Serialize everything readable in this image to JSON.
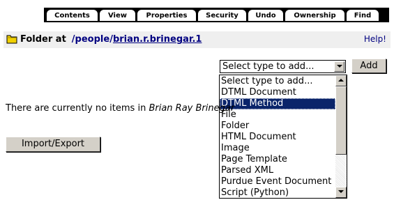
{
  "tabs": [
    {
      "label": "Contents",
      "active": true
    },
    {
      "label": "View"
    },
    {
      "label": "Properties"
    },
    {
      "label": "Security"
    },
    {
      "label": "Undo"
    },
    {
      "label": "Ownership"
    },
    {
      "label": "Find"
    }
  ],
  "header": {
    "prefix": "Folder at",
    "path_root": "/people",
    "path_sep": "/",
    "path_leaf": "brian.r.brinegar.1",
    "help": "Help!",
    "folder_icon": "folder-icon",
    "folder_icon_color": "#f0d000"
  },
  "add_form": {
    "selected_value": "Select type to add...",
    "add_label": "Add",
    "options": [
      "Select type to add...",
      "DTML Document",
      "DTML Method",
      "File",
      "Folder",
      "HTML Document",
      "Image",
      "Page Template",
      "Parsed XML",
      "Purdue Event Document",
      "Script (Python)"
    ],
    "highlighted_option": "DTML Method"
  },
  "body": {
    "empty_prefix": "There are currently no items in",
    "empty_owner": "Brian Ray Brinegar"
  },
  "buttons": {
    "import_export": "Import/Export"
  },
  "colors": {
    "highlight": "#0a246a",
    "link": "#000080",
    "header_bg": "#efefef"
  }
}
